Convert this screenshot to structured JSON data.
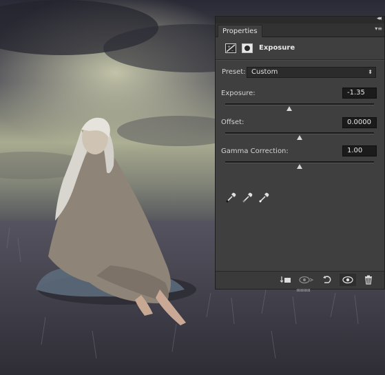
{
  "panel": {
    "tab_label": "Properties",
    "title": "Exposure",
    "icons": [
      "adjustment-layer-icon",
      "layer-mask-icon"
    ]
  },
  "preset": {
    "label": "Preset:",
    "value": "Custom"
  },
  "controls": [
    {
      "label": "Exposure:",
      "value": "-1.35",
      "slider_fraction": 0.43
    },
    {
      "label": "Offset:",
      "value": "0.0000",
      "slider_fraction": 0.5
    },
    {
      "label": "Gamma Correction:",
      "value": "1.00",
      "slider_fraction": 0.5
    }
  ],
  "eyedroppers": [
    "eyedropper-black-point-icon",
    "eyedropper-gray-point-icon",
    "eyedropper-white-point-icon"
  ],
  "footer_buttons": [
    "clip-to-layer-icon",
    "view-previous-state-icon",
    "reset-icon",
    "visibility-eye-icon",
    "delete-icon"
  ],
  "colors": {
    "panel_bg": "#3f3f3f",
    "field_bg": "#1b1b1b",
    "text": "#d8d8d8"
  }
}
